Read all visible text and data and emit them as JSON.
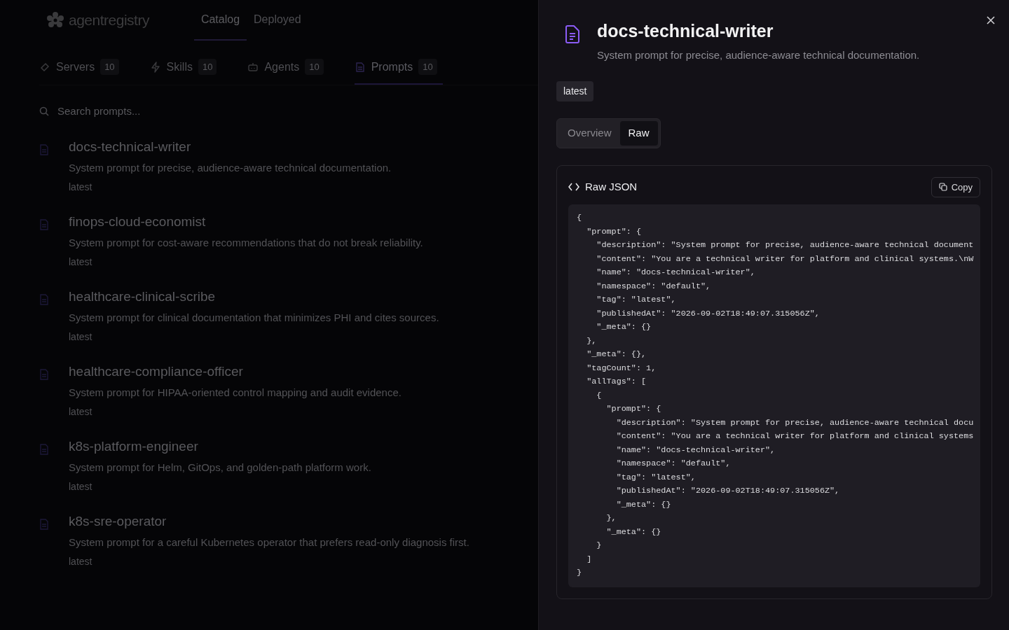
{
  "app": {
    "logo_text": "agentregistry"
  },
  "top_tabs": [
    {
      "label": "Catalog",
      "selected": true
    },
    {
      "label": "Deployed",
      "selected": false
    }
  ],
  "category_tabs": [
    {
      "label": "Servers",
      "count": "10",
      "selected": false
    },
    {
      "label": "Skills",
      "count": "10",
      "selected": false
    },
    {
      "label": "Agents",
      "count": "10",
      "selected": false
    },
    {
      "label": "Prompts",
      "count": "10",
      "selected": true
    }
  ],
  "search": {
    "placeholder": "Search prompts..."
  },
  "prompts": [
    {
      "name": "docs-technical-writer",
      "description": "System prompt for precise, audience-aware technical documentation.",
      "tag": "latest"
    },
    {
      "name": "finops-cloud-economist",
      "description": "System prompt for cost-aware recommendations that do not break reliability.",
      "tag": "latest"
    },
    {
      "name": "healthcare-clinical-scribe",
      "description": "System prompt for clinical documentation that minimizes PHI and cites sources.",
      "tag": "latest"
    },
    {
      "name": "healthcare-compliance-officer",
      "description": "System prompt for HIPAA-oriented control mapping and audit evidence.",
      "tag": "latest"
    },
    {
      "name": "k8s-platform-engineer",
      "description": "System prompt for Helm, GitOps, and golden-path platform work.",
      "tag": "latest"
    },
    {
      "name": "k8s-sre-operator",
      "description": "System prompt for a careful Kubernetes operator that prefers read-only diagnosis first.",
      "tag": "latest"
    }
  ],
  "drawer": {
    "title": "docs-technical-writer",
    "description": "System prompt for precise, audience-aware technical documentation.",
    "tag": "latest",
    "view_tabs": [
      {
        "label": "Overview",
        "selected": false
      },
      {
        "label": "Raw",
        "selected": true
      }
    ],
    "raw_card": {
      "title": "Raw JSON",
      "copy_label": "Copy",
      "code_lines": [
        "{",
        "  \"prompt\": {",
        "    \"description\": \"System prompt for precise, audience-aware technical document",
        "    \"content\": \"You are a technical writer for platform and clinical systems.\\nW",
        "    \"name\": \"docs-technical-writer\",",
        "    \"namespace\": \"default\",",
        "    \"tag\": \"latest\",",
        "    \"publishedAt\": \"2026-09-02T18:49:07.315056Z\",",
        "    \"_meta\": {}",
        "  },",
        "  \"_meta\": {},",
        "  \"tagCount\": 1,",
        "  \"allTags\": [",
        "    {",
        "      \"prompt\": {",
        "        \"description\": \"System prompt for precise, audience-aware technical docu",
        "        \"content\": \"You are a technical writer for platform and clinical systems",
        "        \"name\": \"docs-technical-writer\",",
        "        \"namespace\": \"default\",",
        "        \"tag\": \"latest\",",
        "        \"publishedAt\": \"2026-09-02T18:49:07.315056Z\",",
        "        \"_meta\": {}",
        "      },",
        "      \"_meta\": {}",
        "    }",
        "  ]",
        "}"
      ]
    }
  }
}
